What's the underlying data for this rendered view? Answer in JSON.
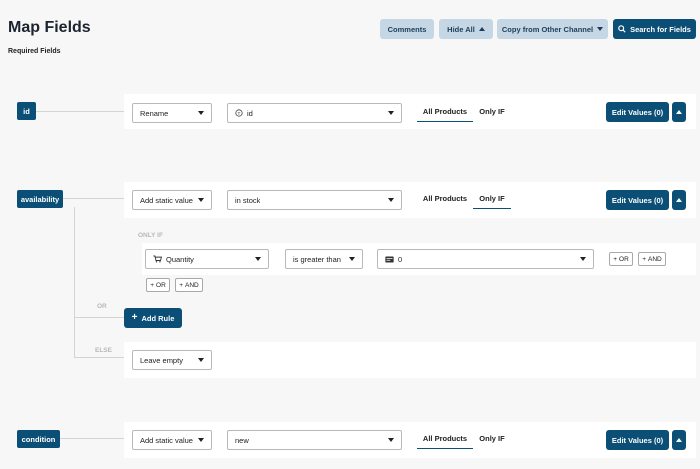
{
  "header": {
    "title": "Map Fields",
    "subtitle": "Required Fields",
    "buttons": {
      "comments": "Comments",
      "hide_all": "Hide All",
      "copy": "Copy from Other Channel",
      "search": "Search for Fields"
    }
  },
  "fields": [
    {
      "name": "id",
      "mode": "Rename",
      "value": "id",
      "value_icon": "text-field-icon",
      "tabs": [
        "All Products",
        "Only IF"
      ],
      "active_tab": 0,
      "edit_label": "Edit Values (0)"
    },
    {
      "name": "availability",
      "mode": "Add static value",
      "value": "in stock",
      "tabs": [
        "All Products",
        "Only IF"
      ],
      "active_tab": 1,
      "edit_label": "Edit Values (0)",
      "condition": {
        "heading": "ONLY IF",
        "field": "Quantity",
        "field_icon": "cart-icon",
        "operator": "is greater than",
        "value": "0",
        "value_icon": "number-field-icon",
        "or_label": "OR",
        "and_label": "AND",
        "or_divider": "OR",
        "add_rule": "Add Rule",
        "else_label": "ELSE",
        "else_value": "Leave empty"
      }
    },
    {
      "name": "condition",
      "mode": "Add static value",
      "value": "new",
      "tabs": [
        "All Products",
        "Only IF"
      ],
      "active_tab": 0,
      "edit_label": "Edit Values (0)"
    }
  ],
  "colors": {
    "primary": "#0b4f77",
    "secondary": "#c5d7e4",
    "background": "#f7f7f7"
  }
}
